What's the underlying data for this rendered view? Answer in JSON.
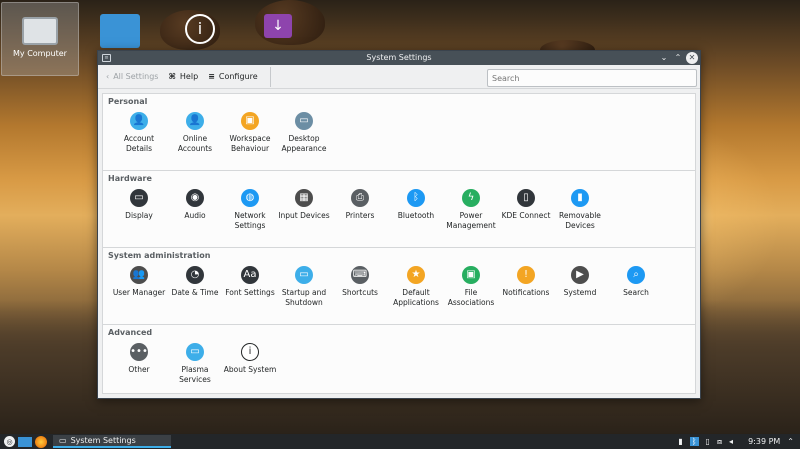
{
  "desktop": {
    "icons": [
      {
        "label": "My Computer",
        "icon": "computer-icon"
      },
      {
        "label": "",
        "icon": "folder-icon"
      },
      {
        "label": "",
        "icon": "info-icon"
      },
      {
        "label": "",
        "icon": "download-icon"
      }
    ]
  },
  "window": {
    "title": "System Settings",
    "toolbar": {
      "all_settings": "All Settings",
      "help": "Help",
      "configure": "Configure"
    },
    "search_placeholder": "Search",
    "sections": [
      {
        "title": "Personal",
        "items": [
          {
            "label": "Account Details",
            "color": "#3daee9",
            "glyph": "👤"
          },
          {
            "label": "Online Accounts",
            "color": "#3daee9",
            "glyph": "👤"
          },
          {
            "label": "Workspace Behaviour",
            "color": "#f3a523",
            "glyph": "▣"
          },
          {
            "label": "Desktop Appearance",
            "color": "#6c8ea4",
            "glyph": "▭"
          }
        ]
      },
      {
        "title": "Hardware",
        "items": [
          {
            "label": "Display",
            "color": "#31363b",
            "glyph": "▭"
          },
          {
            "label": "Audio",
            "color": "#31363b",
            "glyph": "◉"
          },
          {
            "label": "Network Settings",
            "color": "#1d99f3",
            "glyph": "◍"
          },
          {
            "label": "Input Devices",
            "color": "#4d4d4d",
            "glyph": "▦"
          },
          {
            "label": "Printers",
            "color": "#5a5f63",
            "glyph": "⎙"
          },
          {
            "label": "Bluetooth",
            "color": "#1d99f3",
            "glyph": "ᛒ"
          },
          {
            "label": "Power Management",
            "color": "#27ae60",
            "glyph": "ϟ"
          },
          {
            "label": "KDE Connect",
            "color": "#31363b",
            "glyph": "▯"
          },
          {
            "label": "Removable Devices",
            "color": "#1d99f3",
            "glyph": "▮"
          }
        ]
      },
      {
        "title": "System administration",
        "items": [
          {
            "label": "User Manager",
            "color": "#4d4d4d",
            "glyph": "👥"
          },
          {
            "label": "Date & Time",
            "color": "#31363b",
            "glyph": "◔"
          },
          {
            "label": "Font Settings",
            "color": "#31363b",
            "glyph": "Aa"
          },
          {
            "label": "Startup and Shutdown",
            "color": "#3daee9",
            "glyph": "▭"
          },
          {
            "label": "Shortcuts",
            "color": "#5a5f63",
            "glyph": "⌨"
          },
          {
            "label": "Default Applications",
            "color": "#f3a523",
            "glyph": "★"
          },
          {
            "label": "File Associations",
            "color": "#27ae60",
            "glyph": "▣"
          },
          {
            "label": "Notifications",
            "color": "#f3a523",
            "glyph": "!"
          },
          {
            "label": "Systemd",
            "color": "#4d4d4d",
            "glyph": "▶"
          },
          {
            "label": "Search",
            "color": "#1d99f3",
            "glyph": "⌕"
          }
        ]
      },
      {
        "title": "Advanced",
        "items": [
          {
            "label": "Other",
            "color": "#5a5f63",
            "glyph": "•••"
          },
          {
            "label": "Plasma Services",
            "color": "#3daee9",
            "glyph": "▭"
          },
          {
            "label": "About System",
            "color": "#ffffff",
            "glyph": "i"
          }
        ]
      }
    ]
  },
  "taskbar": {
    "task_label": "System Settings",
    "clock": "9:39 PM"
  }
}
